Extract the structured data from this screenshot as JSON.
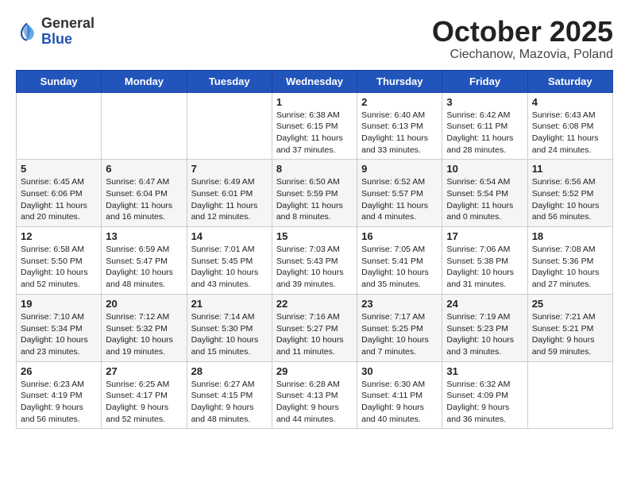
{
  "header": {
    "logo_general": "General",
    "logo_blue": "Blue",
    "title": "October 2025",
    "location": "Ciechanow, Mazovia, Poland"
  },
  "weekdays": [
    "Sunday",
    "Monday",
    "Tuesday",
    "Wednesday",
    "Thursday",
    "Friday",
    "Saturday"
  ],
  "weeks": [
    [
      {
        "day": "",
        "info": ""
      },
      {
        "day": "",
        "info": ""
      },
      {
        "day": "",
        "info": ""
      },
      {
        "day": "1",
        "info": "Sunrise: 6:38 AM\nSunset: 6:15 PM\nDaylight: 11 hours\nand 37 minutes."
      },
      {
        "day": "2",
        "info": "Sunrise: 6:40 AM\nSunset: 6:13 PM\nDaylight: 11 hours\nand 33 minutes."
      },
      {
        "day": "3",
        "info": "Sunrise: 6:42 AM\nSunset: 6:11 PM\nDaylight: 11 hours\nand 28 minutes."
      },
      {
        "day": "4",
        "info": "Sunrise: 6:43 AM\nSunset: 6:08 PM\nDaylight: 11 hours\nand 24 minutes."
      }
    ],
    [
      {
        "day": "5",
        "info": "Sunrise: 6:45 AM\nSunset: 6:06 PM\nDaylight: 11 hours\nand 20 minutes."
      },
      {
        "day": "6",
        "info": "Sunrise: 6:47 AM\nSunset: 6:04 PM\nDaylight: 11 hours\nand 16 minutes."
      },
      {
        "day": "7",
        "info": "Sunrise: 6:49 AM\nSunset: 6:01 PM\nDaylight: 11 hours\nand 12 minutes."
      },
      {
        "day": "8",
        "info": "Sunrise: 6:50 AM\nSunset: 5:59 PM\nDaylight: 11 hours\nand 8 minutes."
      },
      {
        "day": "9",
        "info": "Sunrise: 6:52 AM\nSunset: 5:57 PM\nDaylight: 11 hours\nand 4 minutes."
      },
      {
        "day": "10",
        "info": "Sunrise: 6:54 AM\nSunset: 5:54 PM\nDaylight: 11 hours\nand 0 minutes."
      },
      {
        "day": "11",
        "info": "Sunrise: 6:56 AM\nSunset: 5:52 PM\nDaylight: 10 hours\nand 56 minutes."
      }
    ],
    [
      {
        "day": "12",
        "info": "Sunrise: 6:58 AM\nSunset: 5:50 PM\nDaylight: 10 hours\nand 52 minutes."
      },
      {
        "day": "13",
        "info": "Sunrise: 6:59 AM\nSunset: 5:47 PM\nDaylight: 10 hours\nand 48 minutes."
      },
      {
        "day": "14",
        "info": "Sunrise: 7:01 AM\nSunset: 5:45 PM\nDaylight: 10 hours\nand 43 minutes."
      },
      {
        "day": "15",
        "info": "Sunrise: 7:03 AM\nSunset: 5:43 PM\nDaylight: 10 hours\nand 39 minutes."
      },
      {
        "day": "16",
        "info": "Sunrise: 7:05 AM\nSunset: 5:41 PM\nDaylight: 10 hours\nand 35 minutes."
      },
      {
        "day": "17",
        "info": "Sunrise: 7:06 AM\nSunset: 5:38 PM\nDaylight: 10 hours\nand 31 minutes."
      },
      {
        "day": "18",
        "info": "Sunrise: 7:08 AM\nSunset: 5:36 PM\nDaylight: 10 hours\nand 27 minutes."
      }
    ],
    [
      {
        "day": "19",
        "info": "Sunrise: 7:10 AM\nSunset: 5:34 PM\nDaylight: 10 hours\nand 23 minutes."
      },
      {
        "day": "20",
        "info": "Sunrise: 7:12 AM\nSunset: 5:32 PM\nDaylight: 10 hours\nand 19 minutes."
      },
      {
        "day": "21",
        "info": "Sunrise: 7:14 AM\nSunset: 5:30 PM\nDaylight: 10 hours\nand 15 minutes."
      },
      {
        "day": "22",
        "info": "Sunrise: 7:16 AM\nSunset: 5:27 PM\nDaylight: 10 hours\nand 11 minutes."
      },
      {
        "day": "23",
        "info": "Sunrise: 7:17 AM\nSunset: 5:25 PM\nDaylight: 10 hours\nand 7 minutes."
      },
      {
        "day": "24",
        "info": "Sunrise: 7:19 AM\nSunset: 5:23 PM\nDaylight: 10 hours\nand 3 minutes."
      },
      {
        "day": "25",
        "info": "Sunrise: 7:21 AM\nSunset: 5:21 PM\nDaylight: 9 hours\nand 59 minutes."
      }
    ],
    [
      {
        "day": "26",
        "info": "Sunrise: 6:23 AM\nSunset: 4:19 PM\nDaylight: 9 hours\nand 56 minutes."
      },
      {
        "day": "27",
        "info": "Sunrise: 6:25 AM\nSunset: 4:17 PM\nDaylight: 9 hours\nand 52 minutes."
      },
      {
        "day": "28",
        "info": "Sunrise: 6:27 AM\nSunset: 4:15 PM\nDaylight: 9 hours\nand 48 minutes."
      },
      {
        "day": "29",
        "info": "Sunrise: 6:28 AM\nSunset: 4:13 PM\nDaylight: 9 hours\nand 44 minutes."
      },
      {
        "day": "30",
        "info": "Sunrise: 6:30 AM\nSunset: 4:11 PM\nDaylight: 9 hours\nand 40 minutes."
      },
      {
        "day": "31",
        "info": "Sunrise: 6:32 AM\nSunset: 4:09 PM\nDaylight: 9 hours\nand 36 minutes."
      },
      {
        "day": "",
        "info": ""
      }
    ]
  ]
}
